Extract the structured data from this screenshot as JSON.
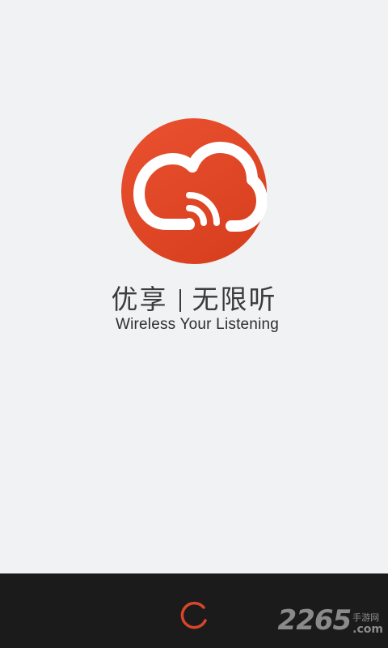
{
  "splash": {
    "logo_icon": "cloud-wireless-icon",
    "slogan_cn_left": "优享",
    "slogan_cn_right": "无限听",
    "slogan_en": "Wireless Your Listening"
  },
  "bottom_bar": {
    "spinner_icon": "loading-spinner-icon",
    "watermark_digits": "2265",
    "watermark_cn": "手游网",
    "watermark_com": ".com"
  },
  "colors": {
    "background": "#f1f2f4",
    "brand_red": "#e4482a",
    "bottom_bar": "#1b1b1b",
    "text": "#3c3c3c"
  }
}
